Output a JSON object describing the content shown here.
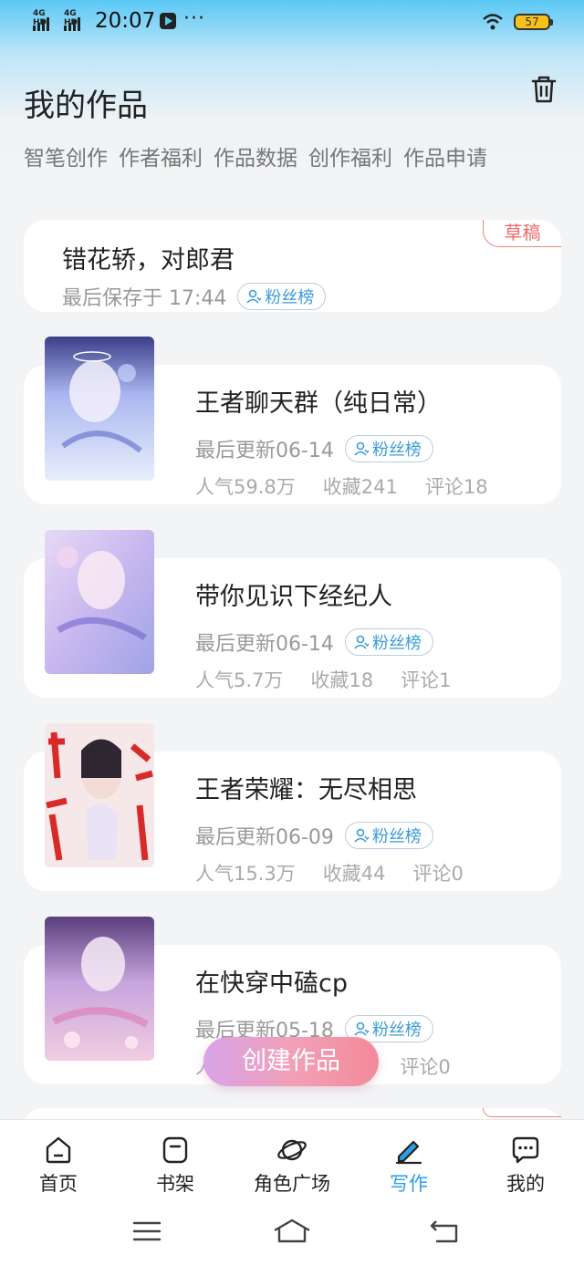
{
  "status": {
    "sig1": "4G HD",
    "sig2": "4G HD",
    "time": "20:07",
    "more": "···",
    "battery": "57"
  },
  "header": {
    "title": "我的作品",
    "links": [
      "智笔创作",
      "作者福利",
      "作品数据",
      "创作福利",
      "作品申请"
    ]
  },
  "draft": {
    "badge": "草稿",
    "title": "错花轿，对郎君",
    "saved": "最后保存于 17:44",
    "fan": "粉丝榜"
  },
  "works": [
    {
      "title": "王者聊天群（纯日常）",
      "updated": "最后更新06-14",
      "fan": "粉丝榜",
      "pop": "人气59.8万",
      "fav": "收藏241",
      "comment": "评论18"
    },
    {
      "title": "带你见识下经纪人",
      "updated": "最后更新06-14",
      "fan": "粉丝榜",
      "pop": "人气5.7万",
      "fav": "收藏18",
      "comment": "评论1"
    },
    {
      "title": "王者荣耀：无尽相思",
      "updated": "最后更新06-09",
      "fan": "粉丝榜",
      "pop": "人气15.3万",
      "fav": "收藏44",
      "comment": "评论0"
    },
    {
      "title": "在快穿中磕cp",
      "updated": "最后更新05-18",
      "fan": "粉丝榜",
      "pop": "人",
      "fav": "0",
      "comment": "评论0"
    }
  ],
  "create_button": "创建作品",
  "tabs": [
    {
      "label": "首页",
      "icon": "home-icon"
    },
    {
      "label": "书架",
      "icon": "bookshelf-icon"
    },
    {
      "label": "角色广场",
      "icon": "planet-icon"
    },
    {
      "label": "写作",
      "icon": "write-icon"
    },
    {
      "label": "我的",
      "icon": "chat-icon"
    }
  ],
  "active_tab": "写作",
  "colors": {
    "accent": "#29a0e6",
    "draft": "#ee6b6b",
    "create_gradient": [
      "#d8a3e8",
      "#f28a9a"
    ]
  }
}
